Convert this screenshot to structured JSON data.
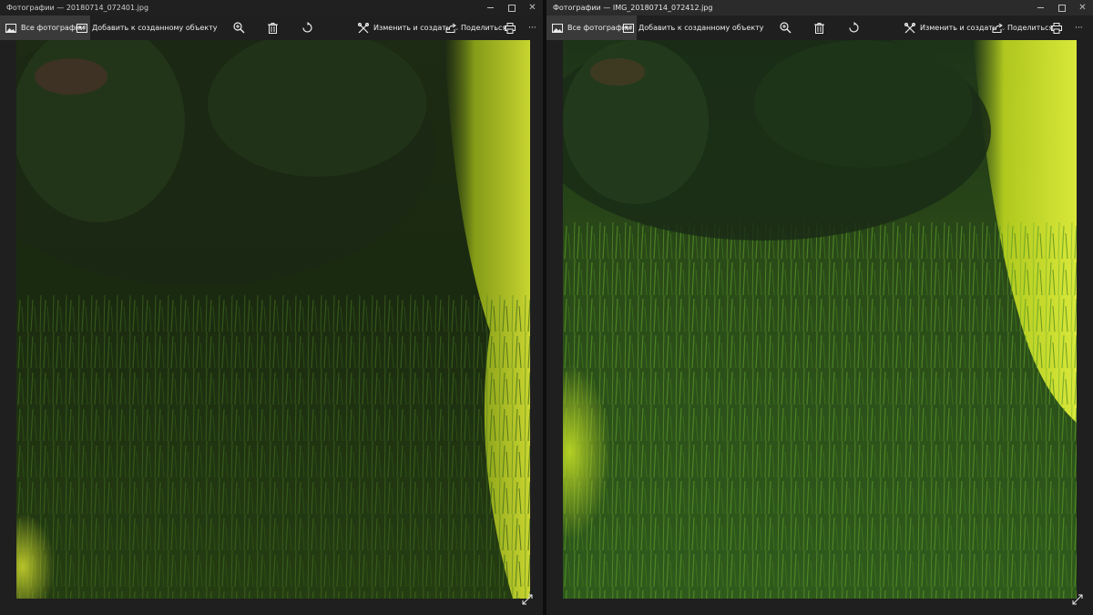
{
  "windows": [
    {
      "title": "Фотографии — 20180714_072401.jpg",
      "toolbar": {
        "all_photos": "Все фотографии",
        "add_to": "Добавить к созданному объекту",
        "edit_create": "Изменить и создать",
        "share": "Поделиться",
        "more": "···"
      }
    },
    {
      "title": "Фотографии — IMG_20180714_072412.jpg",
      "toolbar": {
        "all_photos": "Все фотографии",
        "add_to": "Добавить к созданному объекту",
        "edit_create": "Изменить и создать",
        "share": "Поделиться",
        "more": "···"
      }
    }
  ],
  "caption_buttons": {
    "close": "✕"
  },
  "icons": [
    "photos-icon",
    "slideshow-icon",
    "zoom-in-icon",
    "delete-icon",
    "rotate-icon",
    "edit-create-icon",
    "share-icon",
    "print-icon",
    "more-icon",
    "expand-icon"
  ],
  "colors": {
    "toolbar_bg": "#1f1f1f",
    "active_tab": "#3a3a3a",
    "text": "#ededed"
  }
}
